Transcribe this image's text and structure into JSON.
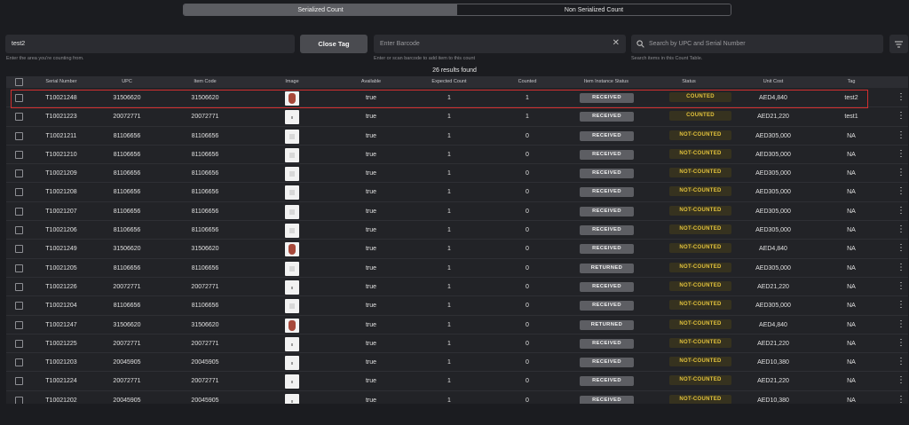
{
  "tabs": [
    {
      "label": "Serialized Count",
      "active": true
    },
    {
      "label": "Non Serialized Count",
      "active": false
    }
  ],
  "area_input": {
    "value": "test2",
    "hint": "Enter the area you're counting from."
  },
  "close_tag_label": "Close Tag",
  "barcode_input": {
    "placeholder": "Enter Barcode",
    "hint": "Enter or scan barcode to add item to this count"
  },
  "search": {
    "placeholder": "Search by UPC and Serial Number",
    "hint": "Search items in this Count Table."
  },
  "results_text": "26 results found",
  "columns": [
    "Serial Number",
    "UPC",
    "Item Code",
    "Image",
    "Available",
    "Expected Count",
    "Counted",
    "Item Instance Status",
    "Status",
    "Unit Cost",
    "Tag"
  ],
  "rows": [
    {
      "serial": "T10021248",
      "upc": "31506620",
      "item_code": "31506620",
      "image": "vase",
      "available": "true",
      "expected": "1",
      "counted": "1",
      "instance_status": "RECEIVED",
      "status": "COUNTED",
      "unit_cost": "AED4,840",
      "tag": "test2"
    },
    {
      "serial": "T10021223",
      "upc": "20072771",
      "item_code": "20072771",
      "image": "small",
      "available": "true",
      "expected": "1",
      "counted": "1",
      "instance_status": "RECEIVED",
      "status": "COUNTED",
      "unit_cost": "AED21,220",
      "tag": "test1"
    },
    {
      "serial": "T10021211",
      "upc": "81106656",
      "item_code": "81106656",
      "image": "box",
      "available": "true",
      "expected": "1",
      "counted": "0",
      "instance_status": "RECEIVED",
      "status": "NOT-COUNTED",
      "unit_cost": "AED305,000",
      "tag": "NA"
    },
    {
      "serial": "T10021210",
      "upc": "81106656",
      "item_code": "81106656",
      "image": "box",
      "available": "true",
      "expected": "1",
      "counted": "0",
      "instance_status": "RECEIVED",
      "status": "NOT-COUNTED",
      "unit_cost": "AED305,000",
      "tag": "NA"
    },
    {
      "serial": "T10021209",
      "upc": "81106656",
      "item_code": "81106656",
      "image": "box",
      "available": "true",
      "expected": "1",
      "counted": "0",
      "instance_status": "RECEIVED",
      "status": "NOT-COUNTED",
      "unit_cost": "AED305,000",
      "tag": "NA"
    },
    {
      "serial": "T10021208",
      "upc": "81106656",
      "item_code": "81106656",
      "image": "box",
      "available": "true",
      "expected": "1",
      "counted": "0",
      "instance_status": "RECEIVED",
      "status": "NOT-COUNTED",
      "unit_cost": "AED305,000",
      "tag": "NA"
    },
    {
      "serial": "T10021207",
      "upc": "81106656",
      "item_code": "81106656",
      "image": "box",
      "available": "true",
      "expected": "1",
      "counted": "0",
      "instance_status": "RECEIVED",
      "status": "NOT-COUNTED",
      "unit_cost": "AED305,000",
      "tag": "NA"
    },
    {
      "serial": "T10021206",
      "upc": "81106656",
      "item_code": "81106656",
      "image": "box",
      "available": "true",
      "expected": "1",
      "counted": "0",
      "instance_status": "RECEIVED",
      "status": "NOT-COUNTED",
      "unit_cost": "AED305,000",
      "tag": "NA"
    },
    {
      "serial": "T10021249",
      "upc": "31506620",
      "item_code": "31506620",
      "image": "vase",
      "available": "true",
      "expected": "1",
      "counted": "0",
      "instance_status": "RECEIVED",
      "status": "NOT-COUNTED",
      "unit_cost": "AED4,840",
      "tag": "NA"
    },
    {
      "serial": "T10021205",
      "upc": "81106656",
      "item_code": "81106656",
      "image": "box",
      "available": "true",
      "expected": "1",
      "counted": "0",
      "instance_status": "RETURNED",
      "status": "NOT-COUNTED",
      "unit_cost": "AED305,000",
      "tag": "NA"
    },
    {
      "serial": "T10021226",
      "upc": "20072771",
      "item_code": "20072771",
      "image": "small",
      "available": "true",
      "expected": "1",
      "counted": "0",
      "instance_status": "RECEIVED",
      "status": "NOT-COUNTED",
      "unit_cost": "AED21,220",
      "tag": "NA"
    },
    {
      "serial": "T10021204",
      "upc": "81106656",
      "item_code": "81106656",
      "image": "box",
      "available": "true",
      "expected": "1",
      "counted": "0",
      "instance_status": "RECEIVED",
      "status": "NOT-COUNTED",
      "unit_cost": "AED305,000",
      "tag": "NA"
    },
    {
      "serial": "T10021247",
      "upc": "31506620",
      "item_code": "31506620",
      "image": "vase",
      "available": "true",
      "expected": "1",
      "counted": "0",
      "instance_status": "RETURNED",
      "status": "NOT-COUNTED",
      "unit_cost": "AED4,840",
      "tag": "NA"
    },
    {
      "serial": "T10021225",
      "upc": "20072771",
      "item_code": "20072771",
      "image": "small",
      "available": "true",
      "expected": "1",
      "counted": "0",
      "instance_status": "RECEIVED",
      "status": "NOT-COUNTED",
      "unit_cost": "AED21,220",
      "tag": "NA"
    },
    {
      "serial": "T10021203",
      "upc": "20045905",
      "item_code": "20045905",
      "image": "small",
      "available": "true",
      "expected": "1",
      "counted": "0",
      "instance_status": "RECEIVED",
      "status": "NOT-COUNTED",
      "unit_cost": "AED10,380",
      "tag": "NA"
    },
    {
      "serial": "T10021224",
      "upc": "20072771",
      "item_code": "20072771",
      "image": "small",
      "available": "true",
      "expected": "1",
      "counted": "0",
      "instance_status": "RECEIVED",
      "status": "NOT-COUNTED",
      "unit_cost": "AED21,220",
      "tag": "NA"
    },
    {
      "serial": "T10021202",
      "upc": "20045905",
      "item_code": "20045905",
      "image": "small",
      "available": "true",
      "expected": "1",
      "counted": "0",
      "instance_status": "RECEIVED",
      "status": "NOT-COUNTED",
      "unit_cost": "AED10,380",
      "tag": "NA"
    }
  ]
}
